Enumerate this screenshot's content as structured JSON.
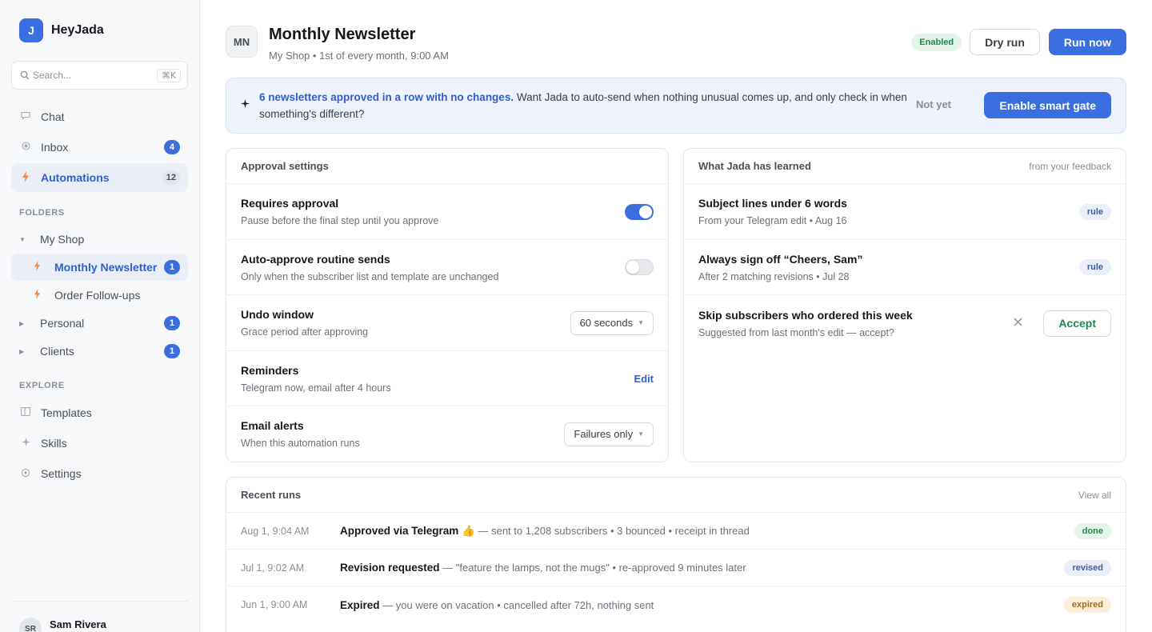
{
  "app": {
    "logo_letter": "J",
    "name": "HeyJada"
  },
  "search": {
    "placeholder": "Search...",
    "shortcut": "⌘K"
  },
  "nav": [
    {
      "label": "Chat",
      "icon": "chat-bubble-icon"
    },
    {
      "label": "Inbox",
      "icon": "inbox-icon",
      "badge": "4"
    },
    {
      "label": "Automations",
      "icon": "bolt-icon",
      "badge": "12",
      "active": true
    }
  ],
  "folders": {
    "label": "FOLDERS",
    "items": [
      {
        "label": "My Shop",
        "expanded": true
      },
      {
        "label": "Monthly Newsletter",
        "badge": "1",
        "active": true
      },
      {
        "label": "Order Follow-ups"
      },
      {
        "label": "Personal",
        "badge": "1"
      },
      {
        "label": "Clients",
        "badge": "1"
      }
    ]
  },
  "explore": {
    "label": "EXPLORE",
    "items": [
      {
        "label": "Templates",
        "icon": "template-icon"
      },
      {
        "label": "Skills",
        "icon": "sparkle-icon"
      },
      {
        "label": "Settings",
        "icon": "gear-icon"
      }
    ]
  },
  "user": {
    "name": "Sam Rivera",
    "initials": "SR"
  },
  "header": {
    "initials": "MN",
    "title": "Monthly Newsletter",
    "subtitle": "My Shop • 1st of every month, 9:00 AM",
    "status": "Enabled",
    "dry_run": "Dry run",
    "run_now": "Run now"
  },
  "banner": {
    "highlight": "6 newsletters approved in a row with no changes.",
    "text": " Want Jada to auto-send when nothing unusual comes up, and only check in when something's different?",
    "not_yet": "Not yet",
    "enable": "Enable smart gate"
  },
  "approval": {
    "title": "Approval settings",
    "rows": [
      {
        "title": "Requires approval",
        "sub": "Pause before the final step until you approve",
        "toggle": true
      },
      {
        "title": "Auto-approve routine sends",
        "sub": "Only when the subscriber list and template are unchanged",
        "toggle": false
      },
      {
        "title": "Undo window",
        "sub": "Grace period after approving",
        "select": "60 seconds"
      },
      {
        "title": "Reminders",
        "sub": "Telegram now, email after 4 hours",
        "link": "Edit"
      },
      {
        "title": "Email alerts",
        "sub": "When this automation runs",
        "select": "Failures only"
      }
    ]
  },
  "learned": {
    "title": "What Jada has learned",
    "meta": "from your feedback",
    "rows": [
      {
        "title": "Subject lines under 6 words",
        "sub": "From your Telegram edit • Aug 16",
        "tag": "rule"
      },
      {
        "title": "Always sign off “Cheers, Sam”",
        "sub": "After 2 matching revisions • Jul 28",
        "tag": "rule"
      },
      {
        "title": "Skip subscribers who ordered this week",
        "sub": "Suggested from last month's edit — accept?",
        "accept": "Accept"
      }
    ]
  },
  "runs": {
    "title": "Recent runs",
    "view_all": "View all",
    "rows": [
      {
        "time": "Aug 1, 9:04 AM",
        "bold": "Approved via Telegram 👍",
        "rest": " — sent to 1,208 subscribers • 3 bounced • receipt in thread",
        "status": "done"
      },
      {
        "time": "Jul 1, 9:02 AM",
        "bold": "Revision requested",
        "rest": " — \"feature the lamps, not the mugs\" • re-approved 9 minutes later",
        "status": "revised"
      },
      {
        "time": "Jun 1, 9:00 AM",
        "bold": "Expired",
        "rest": " — you were on vacation • cancelled after 72h, nothing sent",
        "status": "expired"
      }
    ]
  },
  "colors": {
    "accent": "#3b6fe0",
    "success": "#1f8a4c",
    "warning": "#a66a10"
  }
}
